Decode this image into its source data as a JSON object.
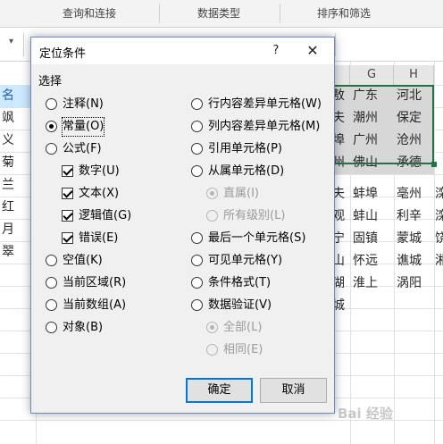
{
  "ribbon": {
    "groups": [
      "查询和连接",
      "数据类型",
      "排序和筛选"
    ]
  },
  "grid": {
    "col_headers": [
      "G",
      "H"
    ],
    "left_column": [
      "名",
      "飒",
      "义",
      "菊",
      "兰",
      "红",
      "月",
      "翠"
    ],
    "rows": [
      [
        "敖",
        "广东",
        "河北"
      ],
      [
        "夫",
        "潮州",
        "保定"
      ],
      [
        "埠",
        "广州",
        "沧州"
      ],
      [
        "州",
        "佛山",
        "承德"
      ],
      [
        "夫",
        "蚌埠",
        "亳州",
        "滦"
      ],
      [
        "观",
        "蚌山",
        "利辛",
        "滦"
      ],
      [
        "宁",
        "固镇",
        "蒙城",
        "饶"
      ],
      [
        "山",
        "怀远",
        "谯城",
        "湘"
      ],
      [
        "湖",
        "淮上",
        "涡阳"
      ],
      [
        "城"
      ]
    ]
  },
  "dialog": {
    "title": "定位条件",
    "help": "?",
    "close": "✕",
    "group_label": "选择",
    "left_options": [
      {
        "label": "注释(N)",
        "checked": false
      },
      {
        "label": "常量(O)",
        "checked": true
      },
      {
        "label": "公式(F)",
        "checked": false
      },
      {
        "label": "数字(U)",
        "checked": true
      },
      {
        "label": "文本(X)",
        "checked": true
      },
      {
        "label": "逻辑值(G)",
        "checked": true
      },
      {
        "label": "错误(E)",
        "checked": true
      },
      {
        "label": "空值(K)",
        "checked": false
      },
      {
        "label": "当前区域(R)",
        "checked": false
      },
      {
        "label": "当前数组(A)",
        "checked": false
      },
      {
        "label": "对象(B)",
        "checked": false
      }
    ],
    "right_options": [
      {
        "label": "行内容差异单元格(W)",
        "checked": false,
        "enabled": true
      },
      {
        "label": "列内容差异单元格(M)",
        "checked": false,
        "enabled": true
      },
      {
        "label": "引用单元格(P)",
        "checked": false,
        "enabled": true
      },
      {
        "label": "从属单元格(D)",
        "checked": false,
        "enabled": true
      },
      {
        "label": "直属(I)",
        "checked": true,
        "enabled": false
      },
      {
        "label": "所有级别(L)",
        "checked": false,
        "enabled": false
      },
      {
        "label": "最后一个单元格(S)",
        "checked": false,
        "enabled": true
      },
      {
        "label": "可见单元格(Y)",
        "checked": false,
        "enabled": true
      },
      {
        "label": "条件格式(T)",
        "checked": false,
        "enabled": true
      },
      {
        "label": "数据验证(V)",
        "checked": false,
        "enabled": true
      },
      {
        "label": "全部(L)",
        "checked": true,
        "enabled": false
      },
      {
        "label": "相同(E)",
        "checked": false,
        "enabled": false
      }
    ],
    "ok_label": "确定",
    "cancel_label": "取消"
  },
  "watermark": "Bai 经验",
  "colors": {
    "accent": "#0078d7",
    "selection_border": "#217346",
    "selected_fill": "#d7d7d7",
    "active_row_header": "#cde8ff"
  }
}
